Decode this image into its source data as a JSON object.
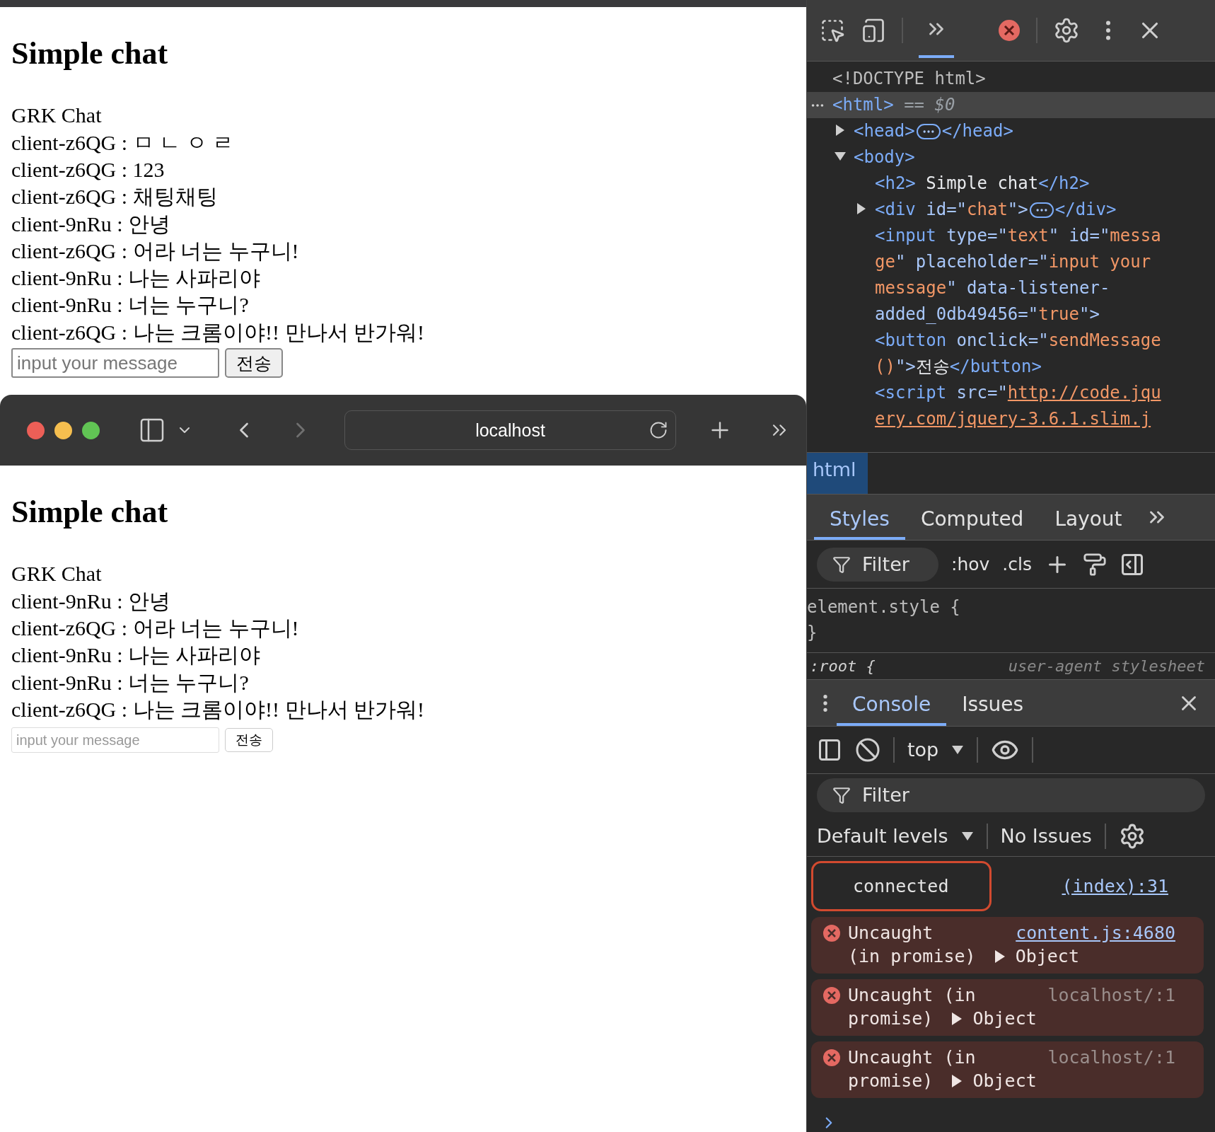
{
  "top_page": {
    "title": "Simple chat",
    "lines": [
      "GRK Chat",
      "client-z6QG : ㅁ ㄴ ㅇ ㄹ",
      "client-z6QG : 123",
      "client-z6QG : 채팅채팅",
      "client-9nRu : 안녕",
      "client-z6QG : 어라 너는 누구니!",
      "client-9nRu : 나는 사파리야",
      "client-9nRu : 너는 누구니?",
      "client-z6QG : 나는 크롬이야!! 만나서 반가워!"
    ],
    "input": {
      "placeholder": "input your message"
    },
    "button": "전송"
  },
  "safari": {
    "address": "localhost",
    "page": {
      "title": "Simple chat",
      "lines": [
        "GRK Chat",
        "client-9nRu : 안녕",
        "client-z6QG : 어라 너는 누구니!",
        "client-9nRu : 나는 사파리야",
        "client-9nRu : 너는 누구니?",
        "client-z6QG : 나는 크롬이야!! 만나서 반가워!"
      ],
      "input": {
        "placeholder": "input your message"
      },
      "button": "전송"
    }
  },
  "devtools": {
    "toolbar_tabs": [
      {
        "kind": "more",
        "selected": true
      }
    ],
    "elements": [
      {
        "lines": [
          [
            {
              "kind": "doctype",
              "t": "<!DOCTYPE html>"
            }
          ]
        ],
        "selected": false
      },
      {
        "lines": [
          [
            {
              "kind": "tag",
              "t": "<html>"
            },
            {
              "kind": "muted",
              "t": " == "
            },
            {
              "kind": "var",
              "t": "$0"
            }
          ]
        ],
        "selected": true,
        "children": [
          {
            "lines": [
              [
                {
                  "kind": "tag",
                  "t": "<head>"
                },
                {
                  "kind": "badge"
                },
                {
                  "kind": "tag",
                  "t": "</head>"
                }
              ]
            ],
            "expanded": false,
            "selected": false
          },
          {
            "lines": [
              [
                {
                  "kind": "tag",
                  "t": "<body>"
                }
              ]
            ],
            "expanded": true,
            "selected": false,
            "children": [
              {
                "lines": [
                  [
                    {
                      "kind": "tag",
                      "t": "<h2>"
                    },
                    {
                      "kind": "text",
                      "t": " Simple chat"
                    },
                    {
                      "kind": "tag",
                      "t": "</h2>"
                    }
                  ]
                ],
                "selected": false
              },
              {
                "lines": [
                  [
                    {
                      "kind": "tag",
                      "t": "<div "
                    },
                    {
                      "kind": "attr",
                      "t": "id=\""
                    },
                    {
                      "kind": "value",
                      "t": "chat"
                    },
                    {
                      "kind": "attr",
                      "t": "\">"
                    },
                    {
                      "kind": "badge"
                    },
                    {
                      "kind": "tag",
                      "t": "</div>"
                    }
                  ]
                ],
                "expanded": false,
                "selected": false
              },
              {
                "lines": [
                  [
                    {
                      "kind": "tag",
                      "t": "<input "
                    },
                    {
                      "kind": "attr",
                      "t": "type=\""
                    },
                    {
                      "kind": "value",
                      "t": "text"
                    },
                    {
                      "kind": "attr",
                      "t": "\" id=\""
                    },
                    {
                      "kind": "value",
                      "t": "messa"
                    }
                  ],
                  [
                    {
                      "kind": "value",
                      "t": "ge"
                    },
                    {
                      "kind": "attr",
                      "t": "\" placeholder=\""
                    },
                    {
                      "kind": "value",
                      "t": "input your"
                    }
                  ],
                  [
                    {
                      "kind": "value",
                      "t": "message"
                    },
                    {
                      "kind": "attr",
                      "t": "\" data-listener-"
                    }
                  ],
                  [
                    {
                      "kind": "attr",
                      "t": "added_0db49456=\""
                    },
                    {
                      "kind": "value",
                      "t": "true"
                    },
                    {
                      "kind": "attr",
                      "t": "\">"
                    }
                  ]
                ],
                "selected": false
              },
              {
                "lines": [
                  [
                    {
                      "kind": "tag",
                      "t": "<button "
                    },
                    {
                      "kind": "attr",
                      "t": "onclick=\""
                    },
                    {
                      "kind": "value",
                      "t": "sendMessage"
                    }
                  ],
                  [
                    {
                      "kind": "value",
                      "t": "()"
                    },
                    {
                      "kind": "attr",
                      "t": "\">"
                    },
                    {
                      "kind": "text",
                      "t": "전송"
                    },
                    {
                      "kind": "tag",
                      "t": "</button>"
                    }
                  ]
                ],
                "selected": false
              },
              {
                "lines": [
                  [
                    {
                      "kind": "tag",
                      "t": "<script "
                    },
                    {
                      "kind": "attr",
                      "t": "src=\""
                    },
                    {
                      "kind": "link",
                      "t": "http://code.jqu"
                    }
                  ],
                  [
                    {
                      "kind": "link",
                      "t": "ery.com/jquery-3.6.1.slim.j"
                    }
                  ]
                ],
                "selected": false
              }
            ]
          }
        ]
      }
    ],
    "breadcrumb": "html",
    "styles_tabs": [
      {
        "label": "Styles",
        "selected": true
      },
      {
        "label": "Computed",
        "selected": false
      },
      {
        "label": "Layout",
        "selected": false
      }
    ],
    "styles_filter": {
      "placeholder": "Filter"
    },
    "hov": ":hov",
    "cls": ".cls",
    "rules": [
      {
        "selector": "element.style {",
        "close": "}"
      }
    ],
    "cut_rule": {
      "selector": ":root {",
      "origin": "user-agent stylesheet"
    },
    "drawer_tabs": [
      {
        "label": "Console",
        "selected": true
      },
      {
        "label": "Issues",
        "selected": false
      }
    ],
    "context": "top",
    "console_filter": {
      "placeholder": "Filter"
    },
    "levels": "Default levels",
    "issues": "No Issues",
    "messages": [
      {
        "kind": "log",
        "text": "connected",
        "source": "(index):31",
        "highlighted": true
      },
      {
        "kind": "error",
        "line1": "Uncaught",
        "line2": "(in promise)",
        "object": "Object",
        "source": "content.js:4680",
        "source_link": true
      },
      {
        "kind": "error",
        "line1": "Uncaught (in",
        "line2": "promise)",
        "object": "Object",
        "source": "localhost/:1",
        "source_link": false
      },
      {
        "kind": "error",
        "line1": "Uncaught (in",
        "line2": "promise)",
        "object": "Object",
        "source": "localhost/:1",
        "source_link": false
      }
    ]
  }
}
